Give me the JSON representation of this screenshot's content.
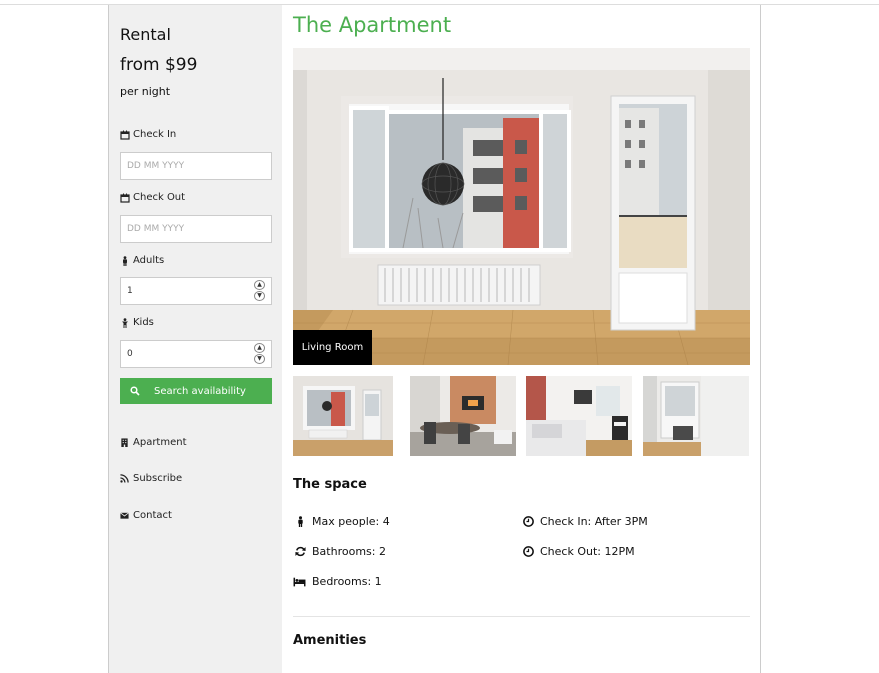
{
  "sidebar": {
    "rental": "Rental",
    "price": "from $99",
    "per_night": "per night",
    "check_in": {
      "label": "Check In",
      "placeholder": "DD MM YYYY"
    },
    "check_out": {
      "label": "Check Out",
      "placeholder": "DD MM YYYY"
    },
    "adults": {
      "label": "Adults",
      "value": "1"
    },
    "kids": {
      "label": "Kids",
      "value": "0"
    },
    "search_label": "Search availability",
    "nav": [
      {
        "label": "Apartment",
        "icon": "building-icon"
      },
      {
        "label": "Subscribe",
        "icon": "rss-icon"
      },
      {
        "label": "Contact",
        "icon": "envelope-icon"
      }
    ]
  },
  "main": {
    "title": "The Apartment",
    "hero_caption": "Living Room",
    "thumbnails": [
      "living-room",
      "dining-room",
      "bedroom",
      "balcony-room"
    ],
    "space_heading": "The space",
    "features": [
      {
        "text": "Max people: 4",
        "icon": "person-icon"
      },
      {
        "text": "Check In: After 3PM",
        "icon": "clock-icon"
      },
      {
        "text": "Bathrooms: 2",
        "icon": "refresh-icon"
      },
      {
        "text": "Check Out: 12PM",
        "icon": "clock-icon"
      },
      {
        "text": "Bedrooms: 1",
        "icon": "bed-icon"
      }
    ],
    "amenities_heading": "Amenities"
  },
  "colors": {
    "accent": "#4caf50",
    "sidebar_bg": "#f0f0f0"
  }
}
